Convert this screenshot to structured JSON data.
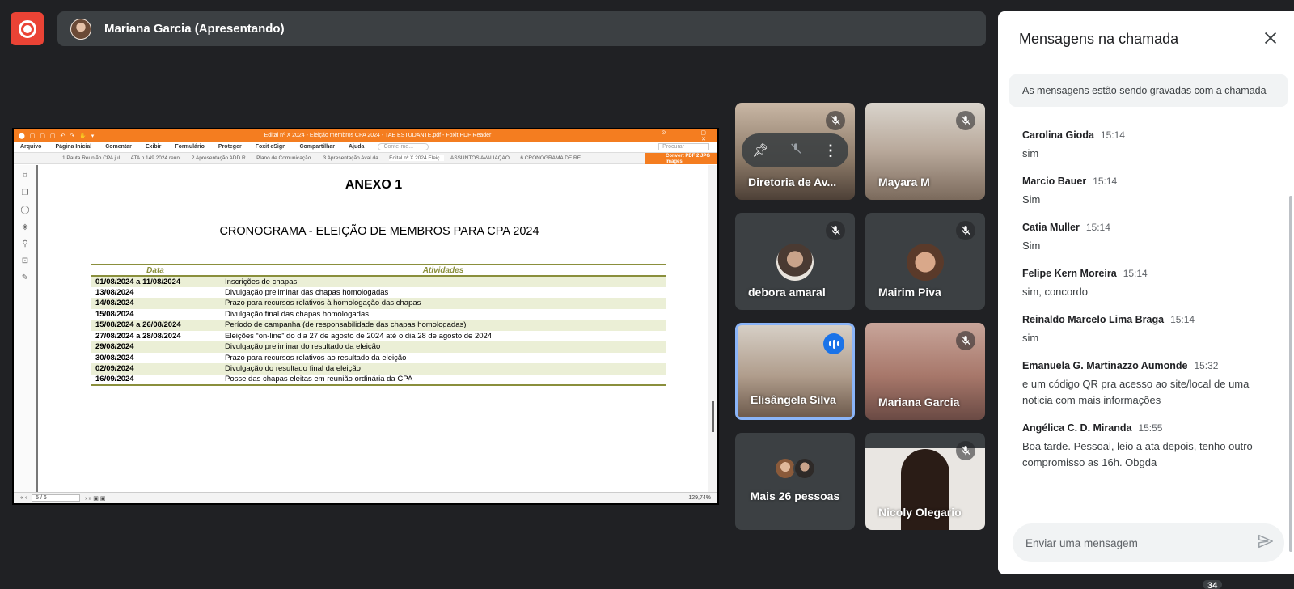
{
  "presenter": {
    "name": "Mariana Garcia (Apresentando)"
  },
  "screen": {
    "window_title": "Edital nº X 2024 - Eleição membros CPA 2024 - TAE ESTUDANTE.pdf - Foxit PDF Reader",
    "menu": [
      "Arquivo",
      "Página Inicial",
      "Comentar",
      "Exibir",
      "Formulário",
      "Proteger",
      "Foxit eSign",
      "Compartilhar",
      "Ajuda"
    ],
    "search_placeholder": "Conte-me...",
    "find_placeholder": "Procurar",
    "tabs": [
      "1 Pauta Reunião CPA jul...",
      "ATA n 149 2024 reuni...",
      "2 Apresentação ADD R...",
      "Plano de Comunicação ...",
      "3 Apresentação Aval da...",
      "Edital nº X 2024 Eleiç...",
      "ASSUNTOS AVALIAÇÃO...",
      "6 CRONOGRAMA DE RE..."
    ],
    "convert_label": "Convert PDF 2 JPG Images",
    "page_indicator": "5 / 6",
    "zoom": "129,74%",
    "doc": {
      "title": "ANEXO 1",
      "subtitle": "CRONOGRAMA - ELEIÇÃO DE MEMBROS PARA CPA 2024",
      "headers": [
        "Data",
        "Atividades"
      ],
      "rows": [
        [
          "01/08/2024 a 11/08/2024",
          "Inscrições de chapas"
        ],
        [
          "13/08/2024",
          "Divulgação preliminar das chapas homologadas"
        ],
        [
          "14/08/2024",
          "Prazo para recursos relativos à homologação das chapas"
        ],
        [
          "15/08/2024",
          "Divulgação final das chapas homologadas"
        ],
        [
          "15/08/2024 a 26/08/2024",
          "Período de campanha (de responsabilidade das chapas homologadas)"
        ],
        [
          "27/08/2024 a 28/08/2024",
          "Eleições “on-line” do dia 27 de agosto de 2024 até o dia 28 de agosto de 2024"
        ],
        [
          "29/08/2024",
          "Divulgação preliminar do resultado da eleição"
        ],
        [
          "30/08/2024",
          "Prazo para recursos relativos ao resultado da eleição"
        ],
        [
          "02/09/2024",
          "Divulgação do resultado final da eleição"
        ],
        [
          "16/09/2024",
          "Posse das chapas eleitas em reunião ordinária da CPA"
        ]
      ]
    }
  },
  "participants": [
    {
      "name": "Diretoria de Av...",
      "muted": true
    },
    {
      "name": "Mayara M",
      "muted": true
    },
    {
      "name": "debora amaral",
      "muted": true
    },
    {
      "name": "Mairim Piva",
      "muted": true
    },
    {
      "name": "Elisângela Silva",
      "muted": false,
      "speaking": true
    },
    {
      "name": "Mariana Garcia",
      "muted": true
    },
    {
      "name": "Mais 26 pessoas"
    },
    {
      "name": "Nicoly Olegario",
      "muted": true
    }
  ],
  "chat": {
    "title": "Mensagens na chamada",
    "recording_notice": "As mensagens estão sendo gravadas com a chamada",
    "messages": [
      {
        "sender": "Carolina Gioda",
        "time": "15:14",
        "text": "sim"
      },
      {
        "sender": "Marcio Bauer",
        "time": "15:14",
        "text": "Sim"
      },
      {
        "sender": "Catia Muller",
        "time": "15:14",
        "text": "Sim"
      },
      {
        "sender": "Felipe Kern Moreira",
        "time": "15:14",
        "text": "sim, concordo"
      },
      {
        "sender": "Reinaldo Marcelo Lima Braga",
        "time": "15:14",
        "text": "sim"
      },
      {
        "sender": "Emanuela G. Martinazzo Aumonde",
        "time": "15:32",
        "text": "e um código QR pra acesso ao site/local de uma noticia com mais informações"
      },
      {
        "sender": "Angélica C. D. Miranda",
        "time": "15:55",
        "text": "Boa tarde. Pessoal, leio a ata depois, tenho outro compromisso as 16h. Obgda"
      }
    ],
    "input_placeholder": "Enviar uma mensagem"
  },
  "participants_count": "34",
  "colors": {
    "accent": "#1a73e8",
    "record": "#ea4335",
    "foxit": "#f47d20",
    "table_header": "#8a8f3c"
  }
}
